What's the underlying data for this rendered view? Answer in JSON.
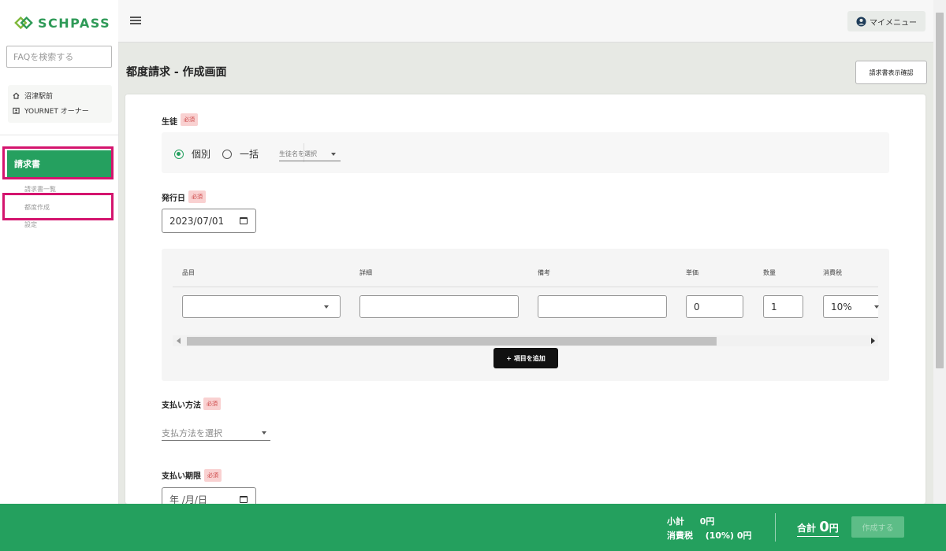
{
  "app": {
    "logo_text": "SCHPASS",
    "brand_color": "#25a05f"
  },
  "sidebar": {
    "faq_placeholder": "FAQを検索する",
    "school_name": "沼津駅前",
    "owner": "YOURNET オーナー",
    "section": "請求書",
    "items": [
      {
        "label": "請求書一覧"
      },
      {
        "label": "都度作成"
      },
      {
        "label": "設定"
      }
    ]
  },
  "header": {
    "menu_label": "マイメニュー",
    "menu_icon": "user-circle-icon"
  },
  "page": {
    "title": "都度請求 - 作成画面",
    "preview_button": "請求書表示確認"
  },
  "form": {
    "required_badge": "必須",
    "student": {
      "label": "生徒",
      "options": [
        {
          "label": "個別",
          "selected": true
        },
        {
          "label": "一括",
          "selected": false
        }
      ],
      "select_placeholder": "生徒名を選択"
    },
    "issue_date": {
      "label": "発行日",
      "value": "2023/07/01"
    },
    "items_table": {
      "columns": [
        "品目",
        "詳細",
        "備考",
        "単価",
        "数量",
        "消費税"
      ],
      "row": {
        "item": "",
        "detail": "",
        "note": "",
        "unit_price": "0",
        "quantity": "1",
        "tax": "10%"
      },
      "add_button": "+ 項目を追加"
    },
    "payment_method": {
      "label": "支払い方法",
      "placeholder": "支払方法を選択"
    },
    "due_date": {
      "label": "支払い期限",
      "placeholder": "年 /月/日"
    }
  },
  "footer": {
    "subtotal_label": "小計",
    "subtotal_value": "0円",
    "tax_label": "消費税",
    "tax_rate": "(10%) 0円",
    "total_label": "合計",
    "total_value": "0",
    "total_unit": "円",
    "create_button": "作成する"
  }
}
